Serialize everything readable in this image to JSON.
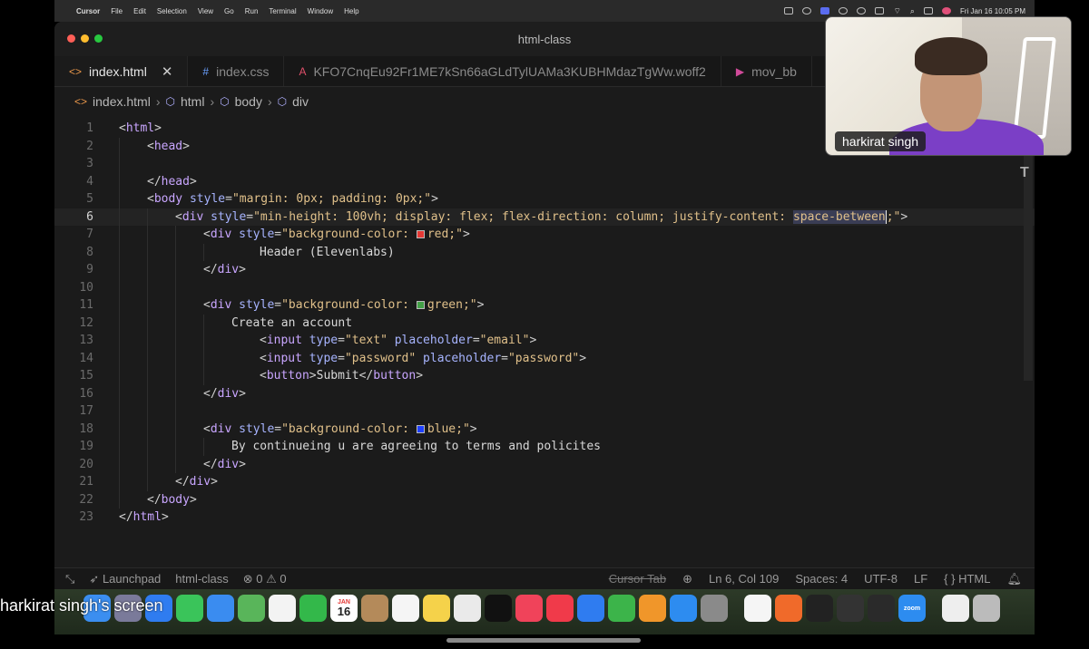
{
  "menubar": {
    "app": "Cursor",
    "items": [
      "File",
      "Edit",
      "Selection",
      "View",
      "Go",
      "Run",
      "Terminal",
      "Window",
      "Help"
    ],
    "datetime": "Fri Jan 16  10:05 PM"
  },
  "window": {
    "title": "html-class"
  },
  "tabs": [
    {
      "label": "index.html",
      "icon": "<>",
      "active": true
    },
    {
      "label": "index.css",
      "icon": "#"
    },
    {
      "label": "KFO7CnqEu92Fr1ME7kSn66aGLdTylUAMa3KUBHMdazTgWw.woff2",
      "icon": "A"
    },
    {
      "label": "mov_bb",
      "icon": "▶"
    }
  ],
  "breadcrumb": [
    "index.html",
    "html",
    "body",
    "div"
  ],
  "code": {
    "current_line": 6,
    "lines": [
      "1",
      "2",
      "3",
      "4",
      "5",
      "6",
      "7",
      "8",
      "9",
      "10",
      "11",
      "12",
      "13",
      "14",
      "15",
      "16",
      "17",
      "18",
      "19",
      "20",
      "21",
      "22",
      "23"
    ],
    "l1": "html",
    "l2": "head",
    "l4": "head",
    "l5_attr": "style",
    "l5_val": "\"margin: 0px; padding: 0px;\"",
    "l6_val_a": "\"min-height: 100vh; display: flex; flex-direction: column; justify-content: ",
    "l6_sel": "space-between",
    "l6_val_b": ";\"",
    "l7_val_a": "\"background-color: ",
    "l7_val_b": "red;\"",
    "l8": "Header (Elevenlabs)",
    "l11_val_a": "\"background-color: ",
    "l11_val_b": "green;\"",
    "l12": "Create an account",
    "l13_type": "\"text\"",
    "l13_ph": "\"email\"",
    "l14_type": "\"password\"",
    "l14_ph": "\"password\"",
    "l15": "Submit",
    "l18_val_a": "\"background-color: ",
    "l18_val_b": "blue;\"",
    "l19": "By continueing u are agreeing to terms and policites",
    "colors": {
      "red": "#e53935",
      "green": "#43a047",
      "blue": "#1e40ff"
    }
  },
  "statusbar": {
    "launchpad": "Launchpad",
    "workspace": "html-class",
    "problems": "⊗ 0 ⚠ 0",
    "cursor_tab": "Cursor Tab",
    "position": "Ln 6, Col 109",
    "spaces": "Spaces: 4",
    "encoding": "UTF-8",
    "eol": "LF",
    "language": "HTML"
  },
  "webcam": {
    "name": "harkirat singh"
  },
  "screen_label": "harkirat singh's screen",
  "dock": {
    "date_day": "16",
    "date_month": "JAN",
    "zoom": "zoom"
  }
}
